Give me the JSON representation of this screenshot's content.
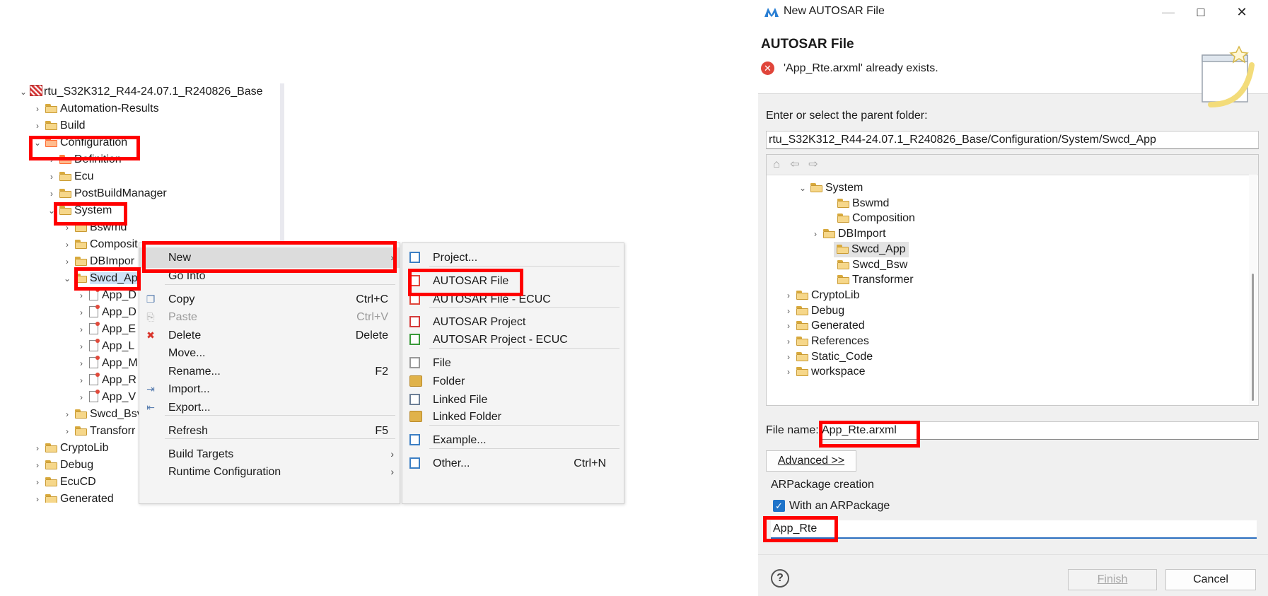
{
  "explorer": {
    "root": "rtu_S32K312_R44-24.07.1_R240826_Base",
    "items": [
      "Automation-Results",
      "Build",
      "Configuration",
      "Definition",
      "Ecu",
      "PostBuildManager",
      "System",
      "Bswmd",
      "Composit",
      "DBImpor",
      "Swcd_Ap",
      "App_D",
      "App_D",
      "App_E",
      "App_L",
      "App_M",
      "App_R",
      "App_V",
      "Swcd_Bsv",
      "Transforr",
      "CryptoLib",
      "Debug",
      "EcuCD",
      "Generated"
    ]
  },
  "context_menu": {
    "items": [
      {
        "label": "New",
        "shortcut": "",
        "icon": "",
        "submenu": true
      },
      {
        "label": "Go Into",
        "shortcut": "",
        "icon": ""
      },
      {
        "label": "Copy",
        "shortcut": "Ctrl+C",
        "icon": "copy-icon"
      },
      {
        "label": "Paste",
        "shortcut": "Ctrl+V",
        "icon": "paste-icon",
        "disabled": true
      },
      {
        "label": "Delete",
        "shortcut": "Delete",
        "icon": "delete-icon"
      },
      {
        "label": "Move...",
        "shortcut": ""
      },
      {
        "label": "Rename...",
        "shortcut": "F2"
      },
      {
        "label": "Import...",
        "shortcut": "",
        "icon": "import-icon"
      },
      {
        "label": "Export...",
        "shortcut": "",
        "icon": "export-icon"
      },
      {
        "label": "Refresh",
        "shortcut": "F5"
      },
      {
        "label": "Build Targets",
        "shortcut": "",
        "submenu": true
      },
      {
        "label": "Runtime Configuration",
        "shortcut": "",
        "submenu": true
      }
    ]
  },
  "new_submenu": {
    "items": [
      {
        "label": "Project...",
        "shortcut": "",
        "icon": "project-icon"
      },
      {
        "label": "AUTOSAR File",
        "shortcut": "",
        "icon": "autosar-file-icon"
      },
      {
        "label": "AUTOSAR File - ECUC",
        "shortcut": "",
        "icon": "autosar-file-ecuc-icon"
      },
      {
        "label": "AUTOSAR Project",
        "shortcut": "",
        "icon": "autosar-project-icon"
      },
      {
        "label": "AUTOSAR Project - ECUC",
        "shortcut": "",
        "icon": "autosar-project-ecuc-icon"
      },
      {
        "label": "File",
        "shortcut": "",
        "icon": "file-icon"
      },
      {
        "label": "Folder",
        "shortcut": "",
        "icon": "folder-icon"
      },
      {
        "label": "Linked File",
        "shortcut": "",
        "icon": "linked-file-icon"
      },
      {
        "label": "Linked Folder",
        "shortcut": "",
        "icon": "linked-folder-icon"
      },
      {
        "label": "Example...",
        "shortcut": "",
        "icon": "example-icon"
      },
      {
        "label": "Other...",
        "shortcut": "Ctrl+N",
        "icon": "other-icon"
      }
    ]
  },
  "dialog": {
    "window_title": "New AUTOSAR File",
    "header_title": "AUTOSAR File",
    "error_message": "'App_Rte.arxml' already exists.",
    "parent_folder_label": "Enter or select the parent folder:",
    "parent_folder_value": "rtu_S32K312_R44-24.07.1_R240826_Base/Configuration/System/Swcd_App",
    "tree": [
      "System",
      "Bswmd",
      "Composition",
      "DBImport",
      "Swcd_App",
      "Swcd_Bsw",
      "Transformer",
      "CryptoLib",
      "Debug",
      "Generated",
      "References",
      "Static_Code",
      "workspace"
    ],
    "file_name_label": "File name:",
    "file_name_value": "App_Rte.arxml",
    "advanced_label": "Advanced >>",
    "arpackage_group": "ARPackage creation",
    "with_arpackage_label": "With an ARPackage",
    "with_arpackage_checked": true,
    "arpackage_value": "App_Rte",
    "finish_label": "Finish",
    "cancel_label": "Cancel"
  },
  "colors": {
    "highlight": "#ff0000",
    "checkbox": "#1e73c9",
    "folder": "#f6d78a"
  }
}
